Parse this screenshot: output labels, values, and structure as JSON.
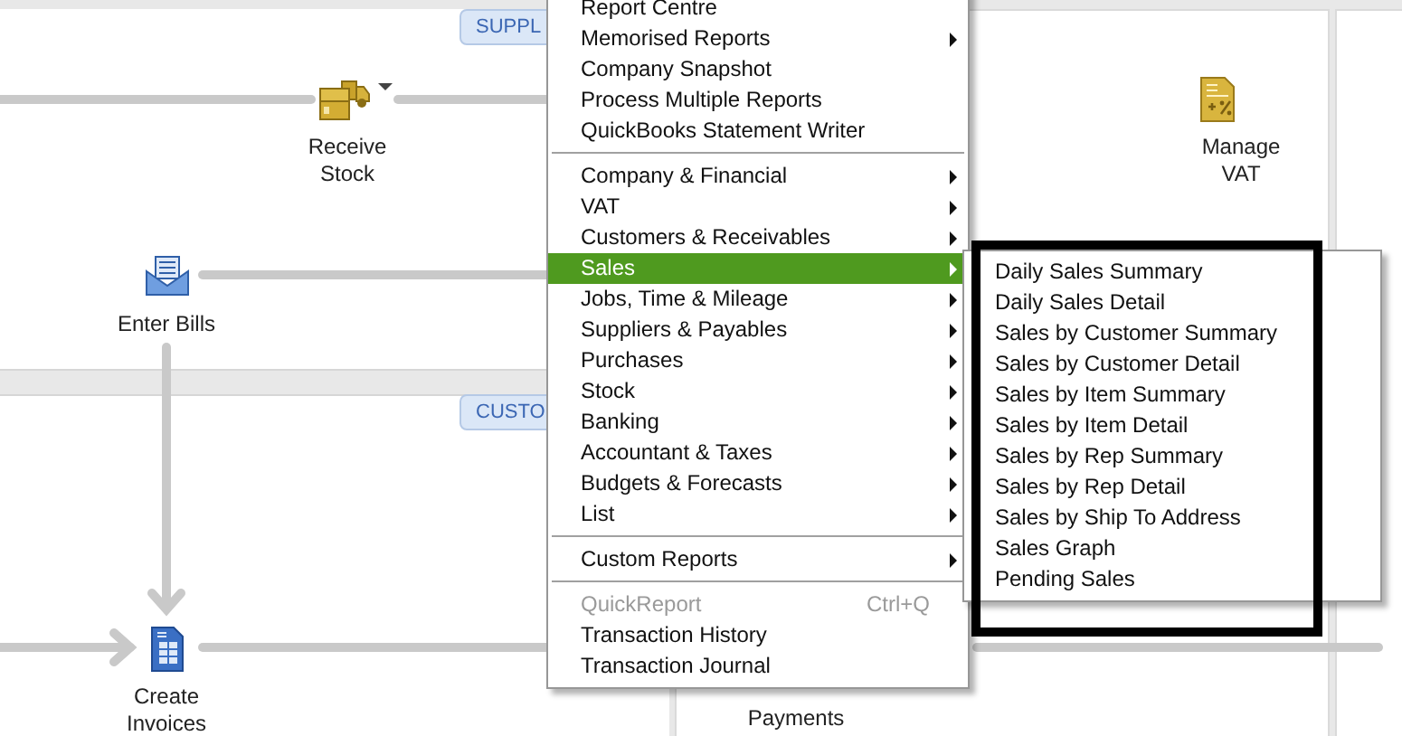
{
  "workflow": {
    "sections": [
      {
        "label": "SUPPL",
        "kind": "suppliers"
      },
      {
        "label": "CUSTO",
        "kind": "customers"
      }
    ],
    "tasks": [
      {
        "label": "Receive\nStock",
        "kind": "stock",
        "dropdown": true
      },
      {
        "label": "Enter Bills",
        "kind": "bills",
        "dropdown": false
      },
      {
        "label": "Create\nInvoices",
        "kind": "invoices",
        "dropdown": false
      },
      {
        "label": "Manage\nVAT",
        "kind": "vat",
        "dropdown": false
      },
      {
        "label": "Payments",
        "kind": "payments",
        "dropdown": false
      }
    ]
  },
  "reports_menu": {
    "items": [
      {
        "kind": "item",
        "label": "Report Centre",
        "submenu": false,
        "selected": false,
        "disabled": false
      },
      {
        "kind": "item",
        "label": "Memorised Reports",
        "submenu": true,
        "selected": false,
        "disabled": false
      },
      {
        "kind": "item",
        "label": "Company Snapshot",
        "submenu": false,
        "selected": false,
        "disabled": false
      },
      {
        "kind": "item",
        "label": "Process Multiple Reports",
        "submenu": false,
        "selected": false,
        "disabled": false
      },
      {
        "kind": "item",
        "label": "QuickBooks Statement Writer",
        "submenu": false,
        "selected": false,
        "disabled": false
      },
      {
        "kind": "separator"
      },
      {
        "kind": "item",
        "label": "Company & Financial",
        "submenu": true,
        "selected": false,
        "disabled": false
      },
      {
        "kind": "item",
        "label": "VAT",
        "submenu": true,
        "selected": false,
        "disabled": false
      },
      {
        "kind": "item",
        "label": "Customers & Receivables",
        "submenu": true,
        "selected": false,
        "disabled": false
      },
      {
        "kind": "item",
        "label": "Sales",
        "submenu": true,
        "selected": true,
        "disabled": false
      },
      {
        "kind": "item",
        "label": "Jobs, Time & Mileage",
        "submenu": true,
        "selected": false,
        "disabled": false
      },
      {
        "kind": "item",
        "label": "Suppliers & Payables",
        "submenu": true,
        "selected": false,
        "disabled": false
      },
      {
        "kind": "item",
        "label": "Purchases",
        "submenu": true,
        "selected": false,
        "disabled": false
      },
      {
        "kind": "item",
        "label": "Stock",
        "submenu": true,
        "selected": false,
        "disabled": false
      },
      {
        "kind": "item",
        "label": "Banking",
        "submenu": true,
        "selected": false,
        "disabled": false
      },
      {
        "kind": "item",
        "label": "Accountant & Taxes",
        "submenu": true,
        "selected": false,
        "disabled": false
      },
      {
        "kind": "item",
        "label": "Budgets & Forecasts",
        "submenu": true,
        "selected": false,
        "disabled": false
      },
      {
        "kind": "item",
        "label": "List",
        "submenu": true,
        "selected": false,
        "disabled": false
      },
      {
        "kind": "separator"
      },
      {
        "kind": "item",
        "label": "Custom Reports",
        "submenu": true,
        "selected": false,
        "disabled": false
      },
      {
        "kind": "separator"
      },
      {
        "kind": "item",
        "label": "QuickReport",
        "shortcut": "Ctrl+Q",
        "submenu": false,
        "selected": false,
        "disabled": true
      },
      {
        "kind": "item",
        "label": "Transaction History",
        "submenu": false,
        "selected": false,
        "disabled": false
      },
      {
        "kind": "item",
        "label": "Transaction Journal",
        "submenu": false,
        "selected": false,
        "disabled": false
      }
    ]
  },
  "sales_submenu": {
    "items": [
      {
        "label": "Daily Sales Summary",
        "selected": false
      },
      {
        "label": "Daily Sales Detail",
        "selected": false
      },
      {
        "label": "Sales by Customer Summary",
        "selected": false
      },
      {
        "label": "Sales by Customer Detail",
        "selected": false
      },
      {
        "label": "Sales by Item Summary",
        "selected": false
      },
      {
        "label": "Sales by Item Detail",
        "selected": false
      },
      {
        "label": "Sales by Rep Summary",
        "selected": false
      },
      {
        "label": "Sales by Rep Detail",
        "selected": false
      },
      {
        "label": "Sales by Ship To Address",
        "selected": false
      },
      {
        "label": "Sales Graph",
        "selected": false
      },
      {
        "label": "Pending Sales",
        "selected": false
      }
    ]
  }
}
